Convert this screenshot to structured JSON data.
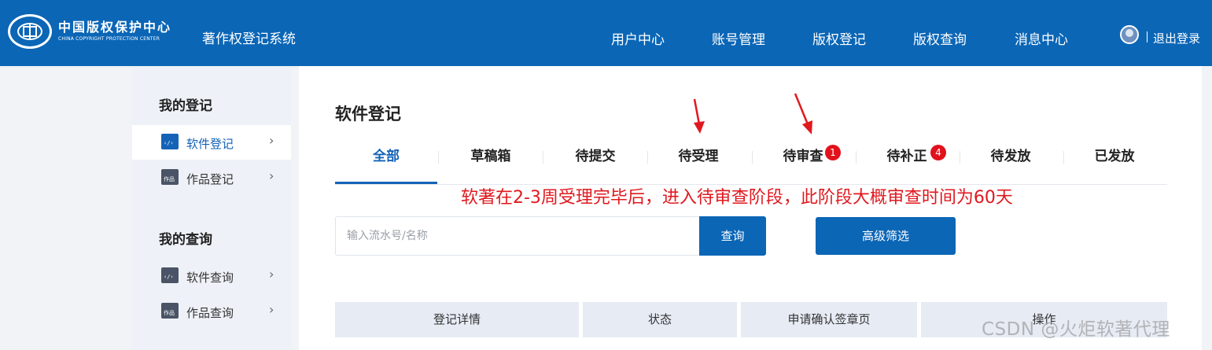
{
  "header": {
    "logo_cn": "中国版权保护中心",
    "logo_en": "CHINA COPYRIGHT PROTECTION CENTER",
    "system_name": "著作权登记系统",
    "nav": [
      "用户中心",
      "账号管理",
      "版权登记",
      "版权查询",
      "消息中心"
    ],
    "logout": "退出登录"
  },
  "sidebar": {
    "group1_title": "我的登记",
    "group1_items": [
      {
        "label": "软件登记",
        "icon": "code-window-icon",
        "active": true
      },
      {
        "label": "作品登记",
        "icon": "artwork-window-icon",
        "active": false
      }
    ],
    "group2_title": "我的查询",
    "group2_items": [
      {
        "label": "软件查询",
        "icon": "code-window-icon",
        "active": false
      },
      {
        "label": "作品查询",
        "icon": "artwork-window-icon",
        "active": false
      }
    ]
  },
  "main": {
    "title": "软件登记",
    "tabs": [
      {
        "label": "全部",
        "active": true
      },
      {
        "label": "草稿箱"
      },
      {
        "label": "待提交"
      },
      {
        "label": "待受理"
      },
      {
        "label": "待审查",
        "badge": "1"
      },
      {
        "label": "待补正",
        "badge": "4"
      },
      {
        "label": "待发放"
      },
      {
        "label": "已发放"
      }
    ],
    "search": {
      "placeholder": "输入流水号/名称",
      "button": "查询"
    },
    "filter_button": "高级筛选",
    "table_headers": [
      "登记详情",
      "状态",
      "申请确认签章页",
      "操作"
    ]
  },
  "annotation": "软著在2-3周受理完毕后，进入待审查阶段，此阶段大概审查时间为60天",
  "watermark": "CSDN @火炬软著代理",
  "colors": {
    "primary": "#0b66b6",
    "badge": "#e1121c",
    "annotation": "#e0191f"
  }
}
